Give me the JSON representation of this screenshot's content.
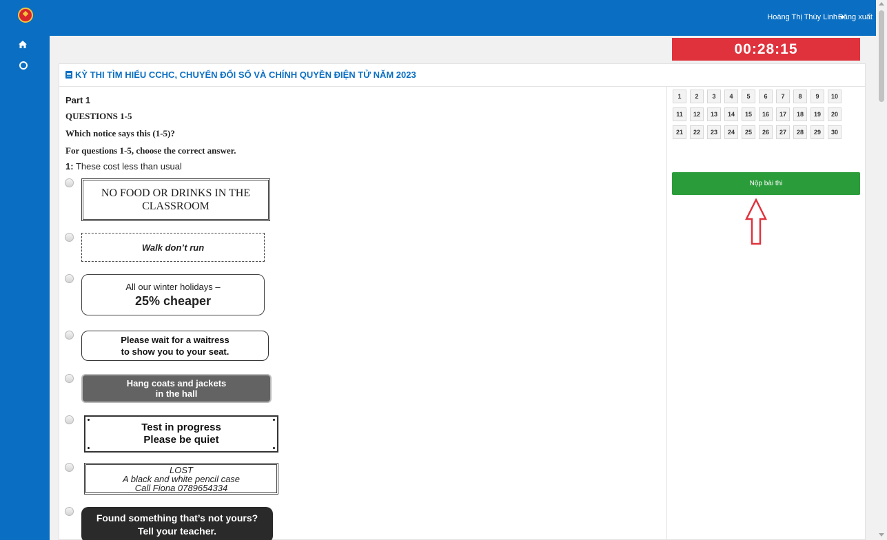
{
  "header": {
    "user_name": "Hoàng Thị Thùy Linh",
    "logout_label": "Đăng xuất"
  },
  "sidebar": {
    "logo_icon": "national-emblem-icon",
    "items": [
      {
        "icon": "home-icon"
      },
      {
        "icon": "circle-icon"
      }
    ]
  },
  "timer": "00:28:15",
  "exam": {
    "title": "KỲ THI TÌM HIỂU CCHC, CHUYỂN ĐỔI SỐ VÀ CHÍNH QUYỀN ĐIỆN TỬ NĂM 2023",
    "part": "Part 1",
    "questions_heading": "QUESTIONS 1-5",
    "instruction_1": "Which notice says this (1-5)?",
    "instruction_2": "For questions 1-5, choose the correct answer.",
    "question_number": "1:",
    "question_text": "These cost less than usual",
    "options": [
      {
        "lines": [
          "NO FOOD OR DRINKS IN THE",
          "CLASSROOM"
        ]
      },
      {
        "lines": [
          "Walk don’t run"
        ]
      },
      {
        "lines": [
          "All our winter holidays –",
          "25% cheaper"
        ]
      },
      {
        "lines": [
          "Please wait for a waitress",
          "to show you to your seat."
        ]
      },
      {
        "lines": [
          "Hang coats and jackets",
          "in the hall"
        ]
      },
      {
        "lines": [
          "Test in progress",
          "Please be quiet"
        ]
      },
      {
        "lines": [
          "LOST",
          "A black and white pencil case",
          "Call Fiona 0789654334"
        ]
      },
      {
        "lines": [
          "Found something that’s not yours?",
          "Tell your teacher."
        ]
      }
    ]
  },
  "question_nav": [
    "1",
    "2",
    "3",
    "4",
    "5",
    "6",
    "7",
    "8",
    "9",
    "10",
    "11",
    "12",
    "13",
    "14",
    "15",
    "16",
    "17",
    "18",
    "19",
    "20",
    "21",
    "22",
    "23",
    "24",
    "25",
    "26",
    "27",
    "28",
    "29",
    "30"
  ],
  "submit_label": "Nộp bài thi",
  "colors": {
    "primary": "#0a6fc2",
    "timer_bg": "#e0323c",
    "submit_bg": "#2a9c3a",
    "arrow": "#e0323c"
  }
}
